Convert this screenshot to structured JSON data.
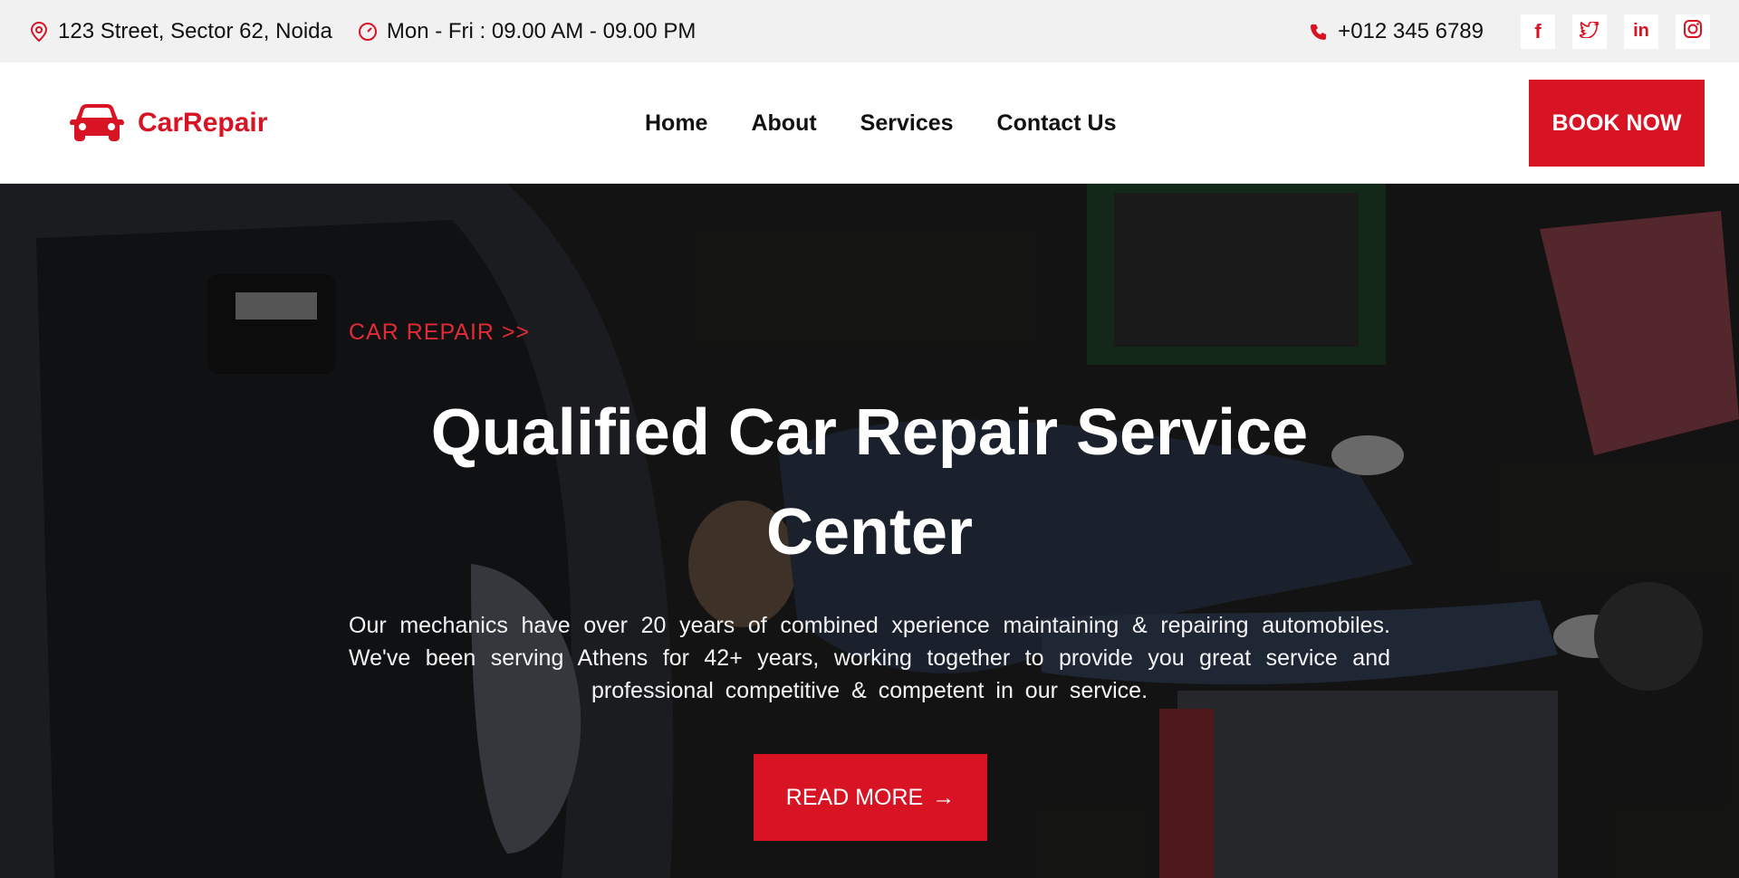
{
  "topbar": {
    "address": "123 Street, Sector 62, Noida",
    "hours": "Mon - Fri : 09.00 AM - 09.00 PM",
    "phone": "+012 345 6789",
    "social": [
      {
        "name": "facebook",
        "label": "f"
      },
      {
        "name": "twitter",
        "label": ""
      },
      {
        "name": "linkedin",
        "label": "in"
      },
      {
        "name": "instagram",
        "label": ""
      }
    ],
    "icons": {
      "address": "map-pin-icon",
      "hours": "clock-icon",
      "phone": "phone-icon"
    }
  },
  "navbar": {
    "brand": "CarRepair",
    "brand_icon": "car-icon",
    "links": [
      "Home",
      "About",
      "Services",
      "Contact Us"
    ],
    "cta": "BOOK NOW"
  },
  "hero": {
    "kicker": "CAR REPAIR >>",
    "title_line1": "Qualified Car Repair Service",
    "title_line2": "Center",
    "description": "Our mechanics have over 20 years of combined xperience maintaining & repairing automobiles. We've been serving Athens for 42+ years, working together to provide you great service and professional competitive & competent in our service.",
    "button": "READ MORE",
    "button_icon": "arrow-right-icon"
  },
  "colors": {
    "accent": "#d81324",
    "topbar_bg": "#f1f1f1",
    "nav_bg": "#ffffff"
  }
}
